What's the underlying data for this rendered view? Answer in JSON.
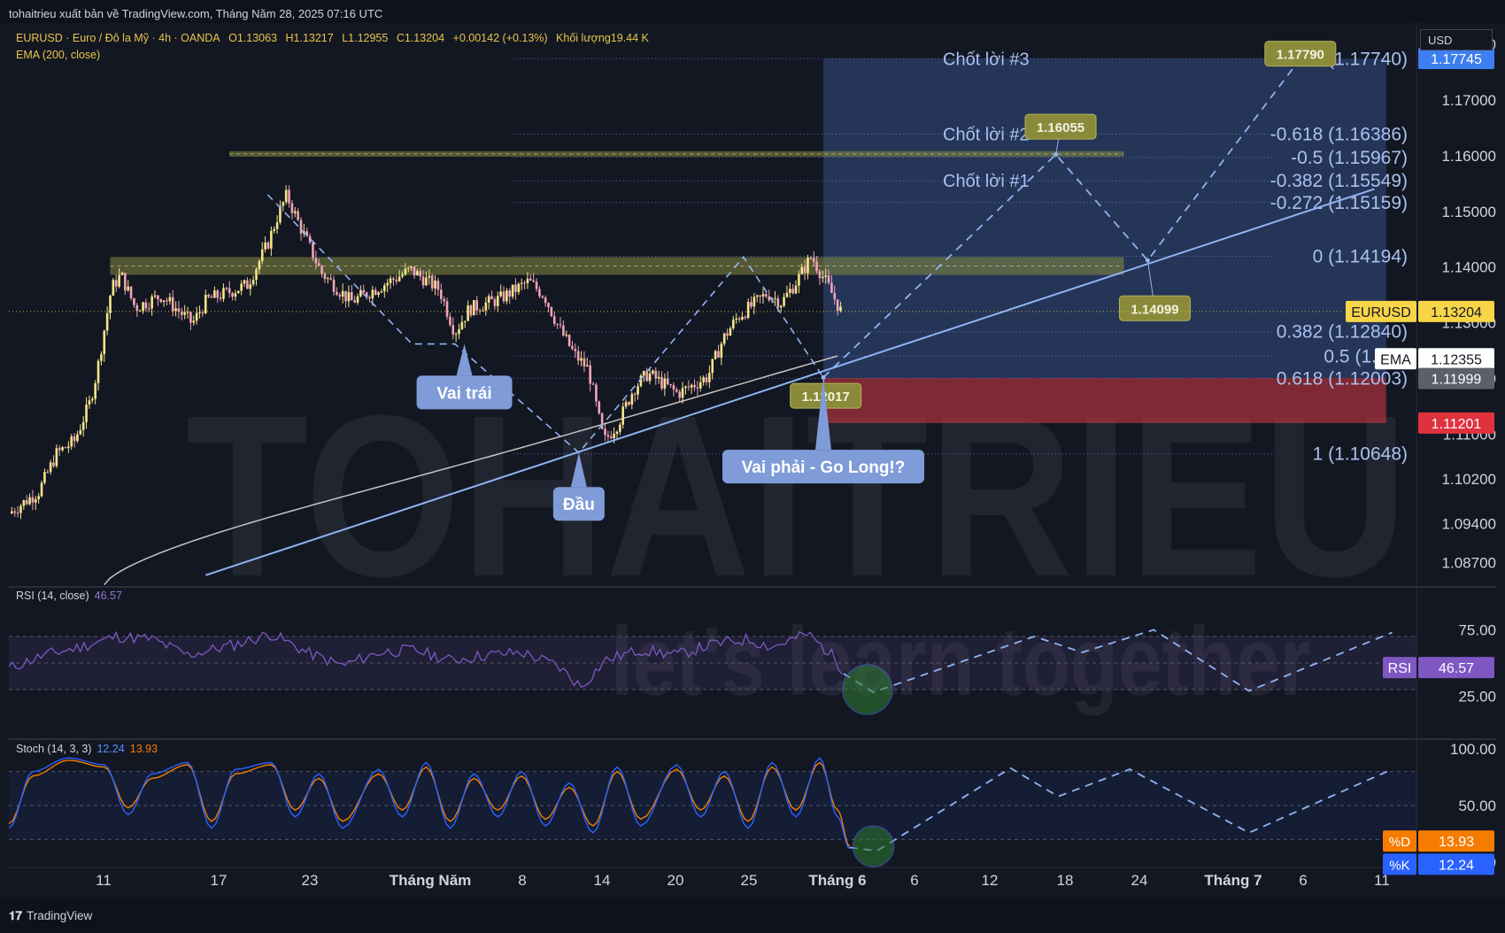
{
  "header": {
    "publisher": "tohaitrieu xuất bản về TradingView.com, Tháng Năm 28, 2025 07:16 UTC"
  },
  "symbol_bar": {
    "symbol": "EURUSD · Euro / Đô la Mỹ · 4h · OANDA",
    "open": "O1.13063",
    "high": "H1.13217",
    "low": "L1.12955",
    "close": "C1.13204",
    "change": "+0.00142 (+0.13%)",
    "volume": "Khối lượng19.44 K",
    "ema_label": "EMA (200, close)"
  },
  "currency_button": "USD",
  "footer": {
    "brand_logo": "𝟏𝟕",
    "brand": "TradingView"
  },
  "watermark": {
    "logo": "TOHAITRIEU",
    "slogan": "let's learn together"
  },
  "colors": {
    "background": "#131722",
    "up_candle": "#f5e58a",
    "down_candle": "#f0a3b8",
    "ema": "#c9c3c1",
    "trend": "#8fb4f2",
    "zone_yellow": "#878a3f",
    "rsi": "#7e57c2",
    "stoch_k": "#2962ff",
    "stoch_d": "#f57c00",
    "price_tag": "#f7d547",
    "stop_zone": "#b8323e",
    "target_zone": "#3c5c9a"
  },
  "chart_data": [
    {
      "type": "candlestick",
      "instrument": "EURUSD",
      "timeframe": "4h",
      "ylim": [
        1.0834,
        1.1838
      ],
      "y_ticks": [
        "1.08700",
        "1.09400",
        "1.10200",
        "1.11000",
        "1.12000",
        "1.13000",
        "1.14000",
        "1.15000",
        "1.16000",
        "1.17000",
        "1.18000"
      ],
      "x_ticks": [
        {
          "label": "11",
          "bold": false
        },
        {
          "label": "17",
          "bold": false
        },
        {
          "label": "23",
          "bold": false
        },
        {
          "label": "Tháng Năm",
          "bold": true
        },
        {
          "label": "8",
          "bold": false
        },
        {
          "label": "14",
          "bold": false
        },
        {
          "label": "20",
          "bold": false
        },
        {
          "label": "25",
          "bold": false
        },
        {
          "label": "Tháng 6",
          "bold": true
        },
        {
          "label": "6",
          "bold": false
        },
        {
          "label": "12",
          "bold": false
        },
        {
          "label": "18",
          "bold": false
        },
        {
          "label": "24",
          "bold": false
        },
        {
          "label": "Tháng 7",
          "bold": true
        },
        {
          "label": "6",
          "bold": false
        },
        {
          "label": "11",
          "bold": false
        }
      ],
      "price_path": [
        [
          0,
          1.0958
        ],
        [
          2.5,
          1.0997
        ],
        [
          4,
          1.1065
        ],
        [
          5.5,
          1.1088
        ],
        [
          6.8,
          1.1157
        ],
        [
          7.4,
          1.1213
        ],
        [
          8.6,
          1.1362
        ],
        [
          9.4,
          1.1386
        ],
        [
          10.6,
          1.1327
        ],
        [
          12.8,
          1.1349
        ],
        [
          15.4,
          1.1299
        ],
        [
          16.6,
          1.1341
        ],
        [
          18.8,
          1.1358
        ],
        [
          20,
          1.1368
        ],
        [
          21.7,
          1.1441
        ],
        [
          22.6,
          1.1495
        ],
        [
          23.3,
          1.1529
        ],
        [
          24.4,
          1.1474
        ],
        [
          26.2,
          1.139
        ],
        [
          28.7,
          1.1338
        ],
        [
          31.2,
          1.1366
        ],
        [
          33.7,
          1.1395
        ],
        [
          36.1,
          1.136
        ],
        [
          37.4,
          1.1283
        ],
        [
          38.6,
          1.1325
        ],
        [
          41.1,
          1.1342
        ],
        [
          43.6,
          1.1374
        ],
        [
          44.9,
          1.1349
        ],
        [
          46.1,
          1.1292
        ],
        [
          47.4,
          1.1244
        ],
        [
          48.6,
          1.1216
        ],
        [
          49.9,
          1.1087
        ],
        [
          51.1,
          1.112
        ],
        [
          52.4,
          1.1182
        ],
        [
          53.6,
          1.1209
        ],
        [
          56.1,
          1.1173
        ],
        [
          58.6,
          1.1203
        ],
        [
          59.9,
          1.1271
        ],
        [
          61.1,
          1.131
        ],
        [
          63.6,
          1.1353
        ],
        [
          64.8,
          1.1336
        ],
        [
          66.1,
          1.1376
        ],
        [
          67.3,
          1.1419
        ],
        [
          68.6,
          1.137
        ],
        [
          69.8,
          1.132
        ]
      ],
      "zones": [
        {
          "kind": "resistance",
          "from": 1.1598,
          "to": 1.1608
        },
        {
          "kind": "support-resistance",
          "from": 1.1386,
          "to": 1.1418
        }
      ],
      "fibonacci": [
        {
          "level": "-1",
          "price": "1.17740",
          "label": "-1 (1.17740)"
        },
        {
          "level": "-0.618",
          "price": "1.16386",
          "label": "-0.618 (1.16386)"
        },
        {
          "level": "-0.5",
          "price": "1.15967",
          "label": "-0.5 (1.15967)"
        },
        {
          "level": "-0.382",
          "price": "1.15549",
          "label": "-0.382 (1.15549)"
        },
        {
          "level": "-0.272",
          "price": "1.15159",
          "label": "-0.272 (1.15159)"
        },
        {
          "level": "0",
          "price": "1.14194",
          "label": "0 (1.14194)"
        },
        {
          "level": "0.382",
          "price": "1.12840",
          "label": "0.382 (1.12840)"
        },
        {
          "level": "0.5",
          "price": "1.124",
          "label": "0.5 (1.124"
        },
        {
          "level": "0.618",
          "price": "1.12003",
          "label": "0.618 (1.12003)"
        },
        {
          "level": "1",
          "price": "1.10648",
          "label": "1 (1.10648)"
        }
      ],
      "take_profit_labels": [
        {
          "text": "Chốt lời #3",
          "price": 1.1774
        },
        {
          "text": "Chốt lời #2",
          "price": 1.1639
        },
        {
          "text": "Chốt lời #1",
          "price": 1.1555
        }
      ],
      "pattern_labels": [
        {
          "text": "Vai trái",
          "x": 38.2,
          "price": 1.1175,
          "pointer_price": 1.1262
        },
        {
          "text": "Đầu",
          "x": 47.8,
          "price": 1.0975,
          "pointer_price": 1.1067
        },
        {
          "text": "Vai phải - Go Long!?",
          "x": 68.3,
          "price": 1.1042,
          "pointer_price": 1.1202
        }
      ],
      "price_callouts": [
        {
          "text": "1.17790",
          "x": 108.3,
          "price": 1.1783
        },
        {
          "text": "1.16055",
          "x": 88.2,
          "price": 1.1652
        },
        {
          "text": "1.14099",
          "x": 96.1,
          "price": 1.1326
        },
        {
          "text": "1.12017",
          "x": 68.5,
          "price": 1.1169
        }
      ],
      "projection_path": [
        [
          68.3,
          1.1202
        ],
        [
          87.8,
          1.1602
        ],
        [
          95.5,
          1.1412
        ],
        [
          108.3,
          1.1774
        ]
      ],
      "trendline": [
        [
          16.5,
          1.0847
        ],
        [
          114.5,
          1.154
        ]
      ],
      "trade_box": {
        "x_from": 68.3,
        "x_to": 115.5,
        "entry": 1.1201,
        "target": 1.1774,
        "stop": 1.112
      },
      "axis_tags": [
        {
          "text": "1.17745",
          "price": 1.17745,
          "style": "target"
        },
        {
          "text": "1.13204",
          "price": 1.13204,
          "style": "price",
          "name": "EURUSD"
        },
        {
          "text": "1.12355",
          "price": 1.12355,
          "style": "ema",
          "name": "EMA"
        },
        {
          "text": "1.11999",
          "price": 1.11999,
          "style": "entry"
        },
        {
          "text": "1.11201",
          "price": 1.11201,
          "style": "stop"
        }
      ]
    },
    {
      "type": "line",
      "indicator": "RSI",
      "label": "RSI (14, close)",
      "value": "46.57",
      "ylim": [
        0,
        100
      ],
      "y_ticks": [
        "75.00",
        "25.00"
      ],
      "band": [
        30,
        70
      ],
      "path": [
        [
          0,
          46
        ],
        [
          3,
          56
        ],
        [
          6,
          62
        ],
        [
          9,
          70
        ],
        [
          12,
          68
        ],
        [
          15,
          56
        ],
        [
          19,
          64
        ],
        [
          22,
          72
        ],
        [
          25,
          58
        ],
        [
          28,
          48
        ],
        [
          31,
          58
        ],
        [
          34,
          60
        ],
        [
          37,
          52
        ],
        [
          40,
          56
        ],
        [
          43,
          58
        ],
        [
          46,
          48
        ],
        [
          48,
          32
        ],
        [
          50,
          52
        ],
        [
          53,
          60
        ],
        [
          56,
          56
        ],
        [
          59,
          64
        ],
        [
          62,
          68
        ],
        [
          64,
          62
        ],
        [
          67,
          72
        ],
        [
          69,
          56
        ],
        [
          70,
          44
        ]
      ],
      "projection": [
        [
          70,
          42
        ],
        [
          72.5,
          28
        ],
        [
          86,
          70
        ],
        [
          90,
          58
        ],
        [
          96,
          75
        ],
        [
          104,
          29
        ],
        [
          116,
          73
        ]
      ],
      "marker": {
        "x": 72,
        "value": 30
      },
      "axis_tag": {
        "name": "RSI",
        "text": "46.57"
      }
    },
    {
      "type": "line",
      "indicator": "Stochastic",
      "label": "Stoch (14, 3, 3)",
      "k_value": "12.24",
      "d_value": "13.93",
      "ylim": [
        0,
        100
      ],
      "y_ticks": [
        "100.00",
        "50.00",
        "0.00"
      ],
      "band": [
        20,
        80
      ],
      "k_path": [
        [
          0,
          30
        ],
        [
          2,
          80
        ],
        [
          5,
          92
        ],
        [
          8,
          86
        ],
        [
          10,
          42
        ],
        [
          12,
          78
        ],
        [
          15,
          88
        ],
        [
          17,
          30
        ],
        [
          19,
          82
        ],
        [
          22,
          88
        ],
        [
          24,
          40
        ],
        [
          26,
          78
        ],
        [
          28,
          30
        ],
        [
          31,
          82
        ],
        [
          33,
          40
        ],
        [
          35,
          88
        ],
        [
          37,
          30
        ],
        [
          39,
          78
        ],
        [
          41,
          40
        ],
        [
          43,
          80
        ],
        [
          45,
          32
        ],
        [
          47,
          70
        ],
        [
          49,
          26
        ],
        [
          51,
          84
        ],
        [
          53,
          32
        ],
        [
          56,
          86
        ],
        [
          58,
          40
        ],
        [
          60,
          80
        ],
        [
          62,
          30
        ],
        [
          64,
          88
        ],
        [
          66,
          40
        ],
        [
          68,
          92
        ],
        [
          69.5,
          40
        ],
        [
          70.5,
          12
        ]
      ],
      "d_path": [
        [
          0,
          34
        ],
        [
          2,
          76
        ],
        [
          5,
          90
        ],
        [
          8,
          84
        ],
        [
          10,
          48
        ],
        [
          12,
          74
        ],
        [
          15,
          86
        ],
        [
          17,
          36
        ],
        [
          19,
          78
        ],
        [
          22,
          86
        ],
        [
          24,
          46
        ],
        [
          26,
          74
        ],
        [
          28,
          36
        ],
        [
          31,
          78
        ],
        [
          33,
          46
        ],
        [
          35,
          84
        ],
        [
          37,
          36
        ],
        [
          39,
          74
        ],
        [
          41,
          46
        ],
        [
          43,
          76
        ],
        [
          45,
          38
        ],
        [
          47,
          66
        ],
        [
          49,
          32
        ],
        [
          51,
          80
        ],
        [
          53,
          38
        ],
        [
          56,
          82
        ],
        [
          58,
          46
        ],
        [
          60,
          76
        ],
        [
          62,
          36
        ],
        [
          64,
          84
        ],
        [
          66,
          46
        ],
        [
          68,
          88
        ],
        [
          69.5,
          46
        ],
        [
          70.5,
          14
        ]
      ],
      "projection": [
        [
          70.5,
          13
        ],
        [
          72.8,
          10
        ],
        [
          84,
          83
        ],
        [
          88,
          58
        ],
        [
          94,
          82
        ],
        [
          104,
          26
        ],
        [
          116,
          82
        ]
      ],
      "marker": {
        "x": 72.5,
        "value": 14
      },
      "axis_tags": [
        {
          "name": "%D",
          "text": "13.93"
        },
        {
          "name": "%K",
          "text": "12.24"
        }
      ]
    }
  ]
}
